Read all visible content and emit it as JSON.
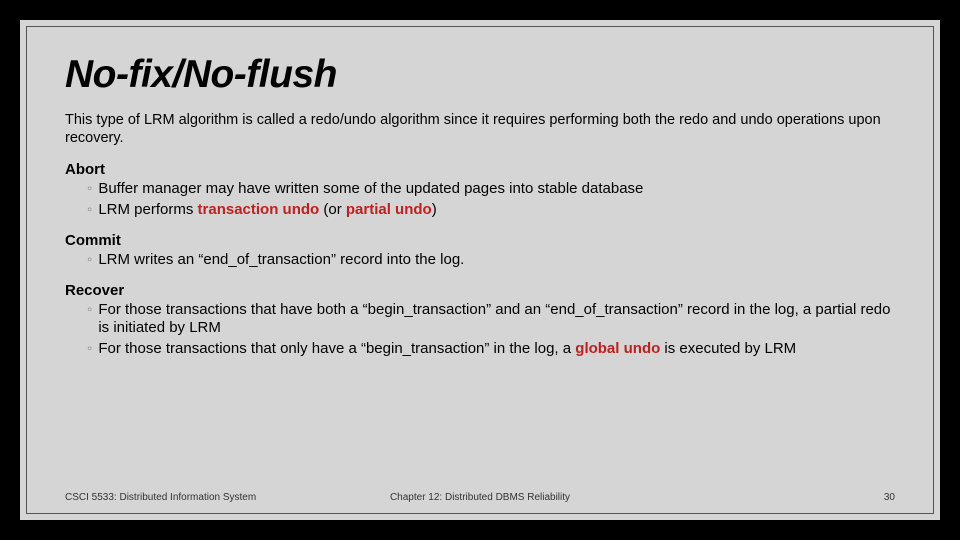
{
  "title": "No-fix/No-flush",
  "intro": "This type of LRM algorithm is called a redo/undo algorithm since it requires performing both the redo and undo operations upon recovery.",
  "sections": {
    "abort": {
      "heading": "Abort",
      "b1": "Buffer manager may have written some of the updated pages into stable database",
      "b2_pre": "LRM  performs ",
      "b2_red1": "transaction undo",
      "b2_mid": " (or ",
      "b2_red2": "partial undo",
      "b2_post": ")"
    },
    "commit": {
      "heading": "Commit",
      "b1": "LRM writes an “end_of_transaction” record into the log."
    },
    "recover": {
      "heading": "Recover",
      "b1": "For those transactions that have both a “begin_transaction” and an “end_of_transaction” record in the log, a partial redo is initiated by LRM",
      "b2_pre": "For those transactions that only have a “begin_transaction” in the log, a ",
      "b2_red": "global undo",
      "b2_post": " is executed by LRM"
    }
  },
  "footer": {
    "left": "CSCI 5533: Distributed Information System",
    "center": "Chapter 12: Distributed DBMS Reliability",
    "right": "30"
  }
}
